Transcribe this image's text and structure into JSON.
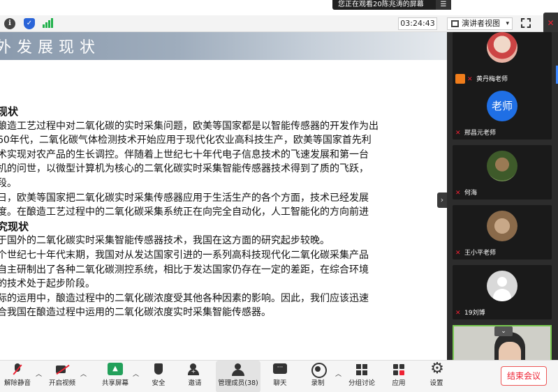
{
  "banner": {
    "text": "您正在观看20陈兆涛的屏幕",
    "menu": "☰"
  },
  "topbar": {
    "timer": "03:24:43",
    "view_label": "演讲者视图"
  },
  "slide": {
    "title": "外发展现状",
    "lines": [
      {
        "text": "现状",
        "heading": true
      },
      {
        "text": "酿造工艺过程中对二氧化碳的实时采集问题，欧美等国家都是以智能传感器的开发作为出"
      },
      {
        "text": "60年代，二氧化碳气体检测技术开始应用于现代化农业高科技生产，欧美等国家首先利"
      },
      {
        "text": "术实现对农产品的生长调控。伴随着上世纪七十年代电子信息技术的飞速发展和第一台"
      },
      {
        "text": "机的问世，以微型计算机为核心的二氧化碳实时采集智能传感器技术得到了质的飞跃，"
      },
      {
        "text": "段。"
      },
      {
        "text": "日，欧美等国家把二氧化碳实时采集传感器应用于生活生产的各个方面，技术已经发展"
      },
      {
        "text": "度。在酿造工艺过程中的二氧化碳采集系统正在向完全自动化，人工智能化的方向前进"
      },
      {
        "text": "究现状",
        "heading": true
      },
      {
        "text": "于国外的二氧化碳实时采集智能传感器技术，我国在这方面的研究起步较晚。"
      },
      {
        "text": "个世纪七十年代末期，我国对从发达国家引进的一系列高科技现代化二氧化碳采集产品"
      },
      {
        "text": "自主研制出了各种二氧化碳测控系统，相比于发达国家仍存在一定的差距，在综合环境"
      },
      {
        "text": "的技术处于起步阶段。"
      },
      {
        "text": "际的运用中，酿造过程中的二氧化碳浓度受其他各种因素的影响。因此，我们应该迅速"
      },
      {
        "text": "合我国在酿造过程中运用的二氧化碳浓度实时采集智能传感器。"
      }
    ]
  },
  "participants": [
    {
      "name": "黄丹梅老师",
      "avatar": "photo1",
      "badge": true
    },
    {
      "name": "邢昌元老师",
      "avatar": "text",
      "avatar_text": "老师"
    },
    {
      "name": "何海",
      "avatar": "photo2"
    },
    {
      "name": "王小平老师",
      "avatar": "photo3"
    },
    {
      "name": "19刘博",
      "avatar": "default"
    }
  ],
  "toolbar": {
    "unmute": "解除静音",
    "start_video": "开启视频",
    "share_screen": "共享屏幕",
    "security": "安全",
    "invite": "邀请",
    "members": "管理成员(38)",
    "chat": "聊天",
    "record": "录制",
    "breakout": "分组讨论",
    "apps": "应用",
    "settings": "设置",
    "end_meeting": "结束会议"
  }
}
